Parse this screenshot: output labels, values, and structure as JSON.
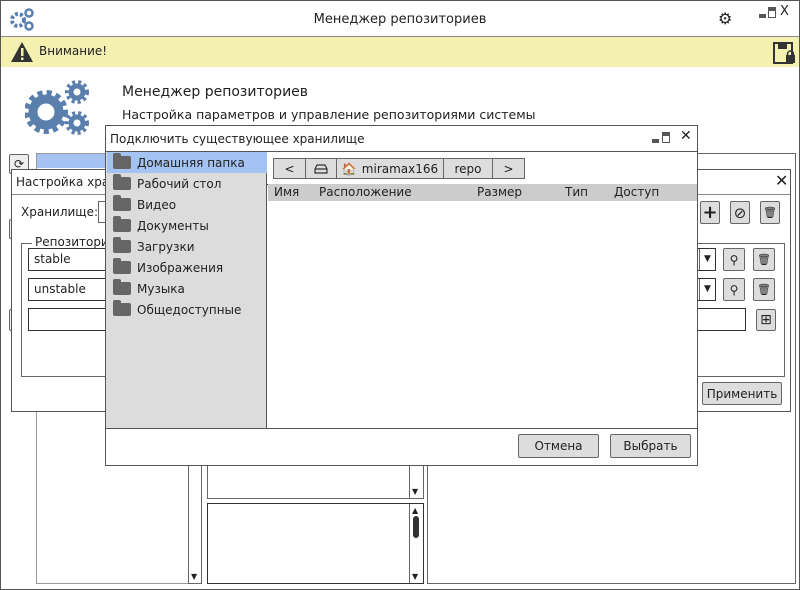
{
  "window": {
    "title": "Менеджер репозиториев"
  },
  "warning": {
    "text": "Внимание!"
  },
  "header": {
    "title": "Менеджер репозиториев",
    "subtitle": "Настройка параметров и управление репозиториями системы"
  },
  "storage_dialog": {
    "title": "Настройка хранилища",
    "storage_label": "Хранилище:",
    "group_label": "Репозитории",
    "repos": [
      "stable",
      "unstable",
      ""
    ],
    "apply_label": "Применить"
  },
  "connect_dialog": {
    "title": "Подключить существующее хранилище",
    "sidebar": [
      {
        "label": "Домашняя папка",
        "selected": true
      },
      {
        "label": "Рабочий стол"
      },
      {
        "label": "Видео"
      },
      {
        "label": "Документы"
      },
      {
        "label": "Загрузки"
      },
      {
        "label": "Изображения"
      },
      {
        "label": "Музыка"
      },
      {
        "label": "Общедоступные"
      }
    ],
    "path": {
      "back": "<",
      "home": "miramax166",
      "repo": "repo",
      "forward": ">"
    },
    "columns": [
      "Имя",
      "Расположение",
      "Размер",
      "Тип",
      "Доступ"
    ],
    "cancel_label": "Отмена",
    "select_label": "Выбрать"
  },
  "colors": {
    "warning_bg": "#f3f0b0",
    "accent": "#5a7fad",
    "selected": "#a4c3f2",
    "sidebar_bg": "#dcdcdc"
  }
}
